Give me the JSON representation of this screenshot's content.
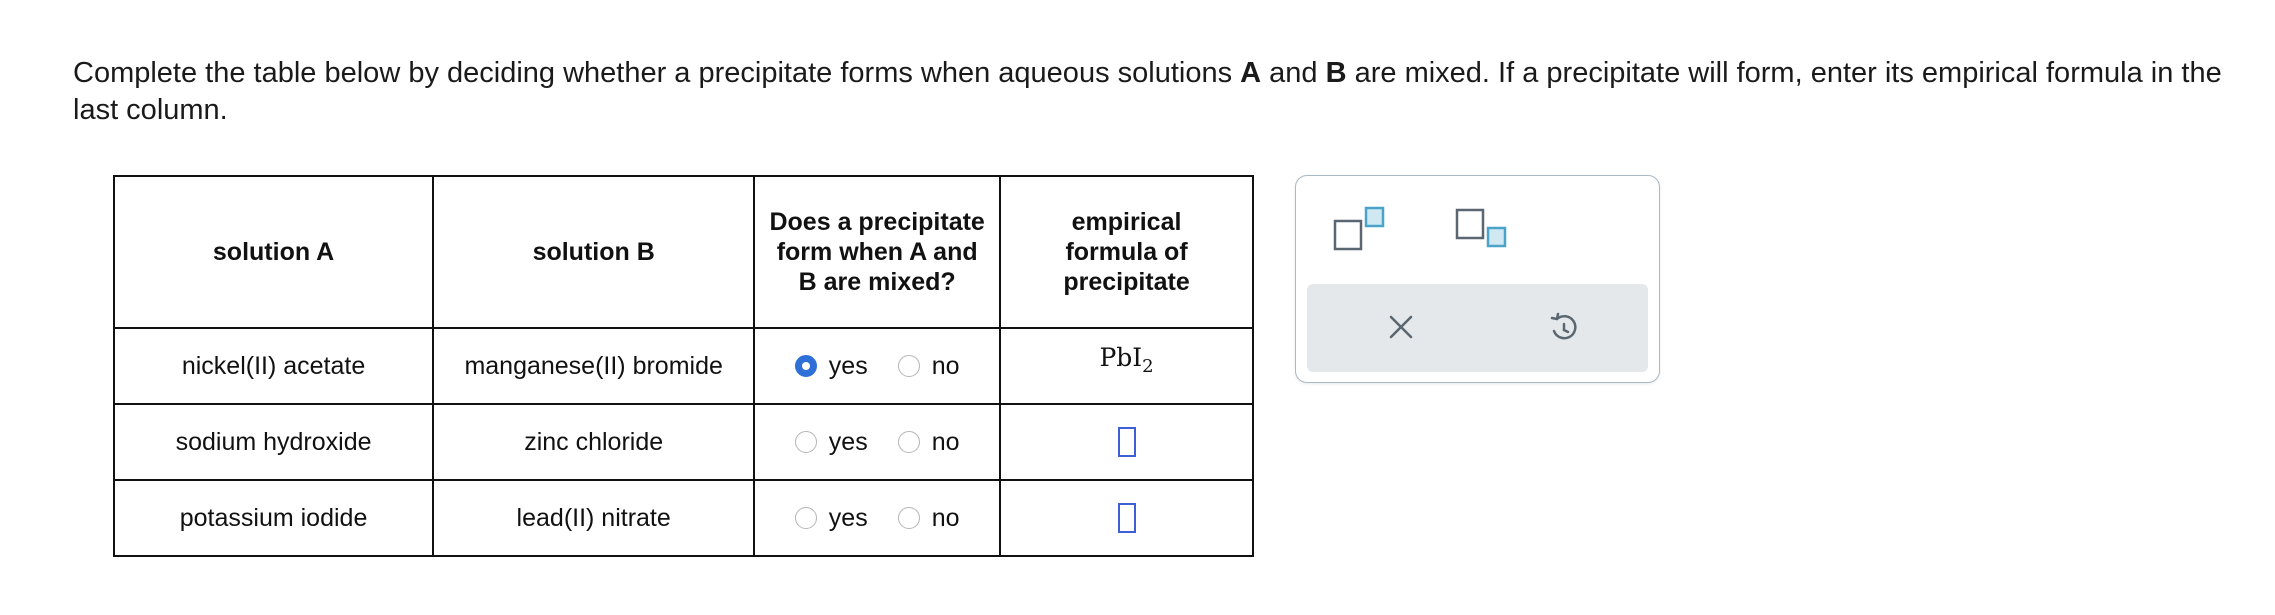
{
  "prompt": {
    "part1": "Complete the table below by deciding whether a precipitate forms when aqueous solutions ",
    "a": "A",
    "part2": " and ",
    "b": "B",
    "part3": " are mixed. If a precipitate will form, enter its empirical formula in the last column."
  },
  "table": {
    "headers": {
      "solution_a": "solution A",
      "solution_b": "solution B",
      "precipitate_q": "Does a precipitate form when A and B are mixed?",
      "formula": "empirical formula of precipitate"
    },
    "options": {
      "yes": "yes",
      "no": "no"
    },
    "rows": [
      {
        "solution_a": "nickel(II) acetate",
        "solution_b": "manganese(II) bromide",
        "selected": "yes",
        "formula_main": "PbI",
        "formula_sub": "2"
      },
      {
        "solution_a": "sodium hydroxide",
        "solution_b": "zinc chloride",
        "selected": "",
        "formula_main": "",
        "formula_sub": ""
      },
      {
        "solution_a": "potassium iodide",
        "solution_b": "lead(II) nitrate",
        "selected": "",
        "formula_main": "",
        "formula_sub": ""
      }
    ]
  },
  "toolbox": {
    "tools": [
      "superscript-tool",
      "subscript-tool"
    ],
    "actions": [
      "clear",
      "undo"
    ]
  },
  "colors": {
    "radio_selected": "#2f6fd8",
    "answer_box": "#3e5fd6",
    "toolbox_border": "#a9b9c6",
    "actions_bg": "#e4e8eb",
    "icon_teal": "#4aa3c8",
    "icon_gray": "#5a6670"
  }
}
